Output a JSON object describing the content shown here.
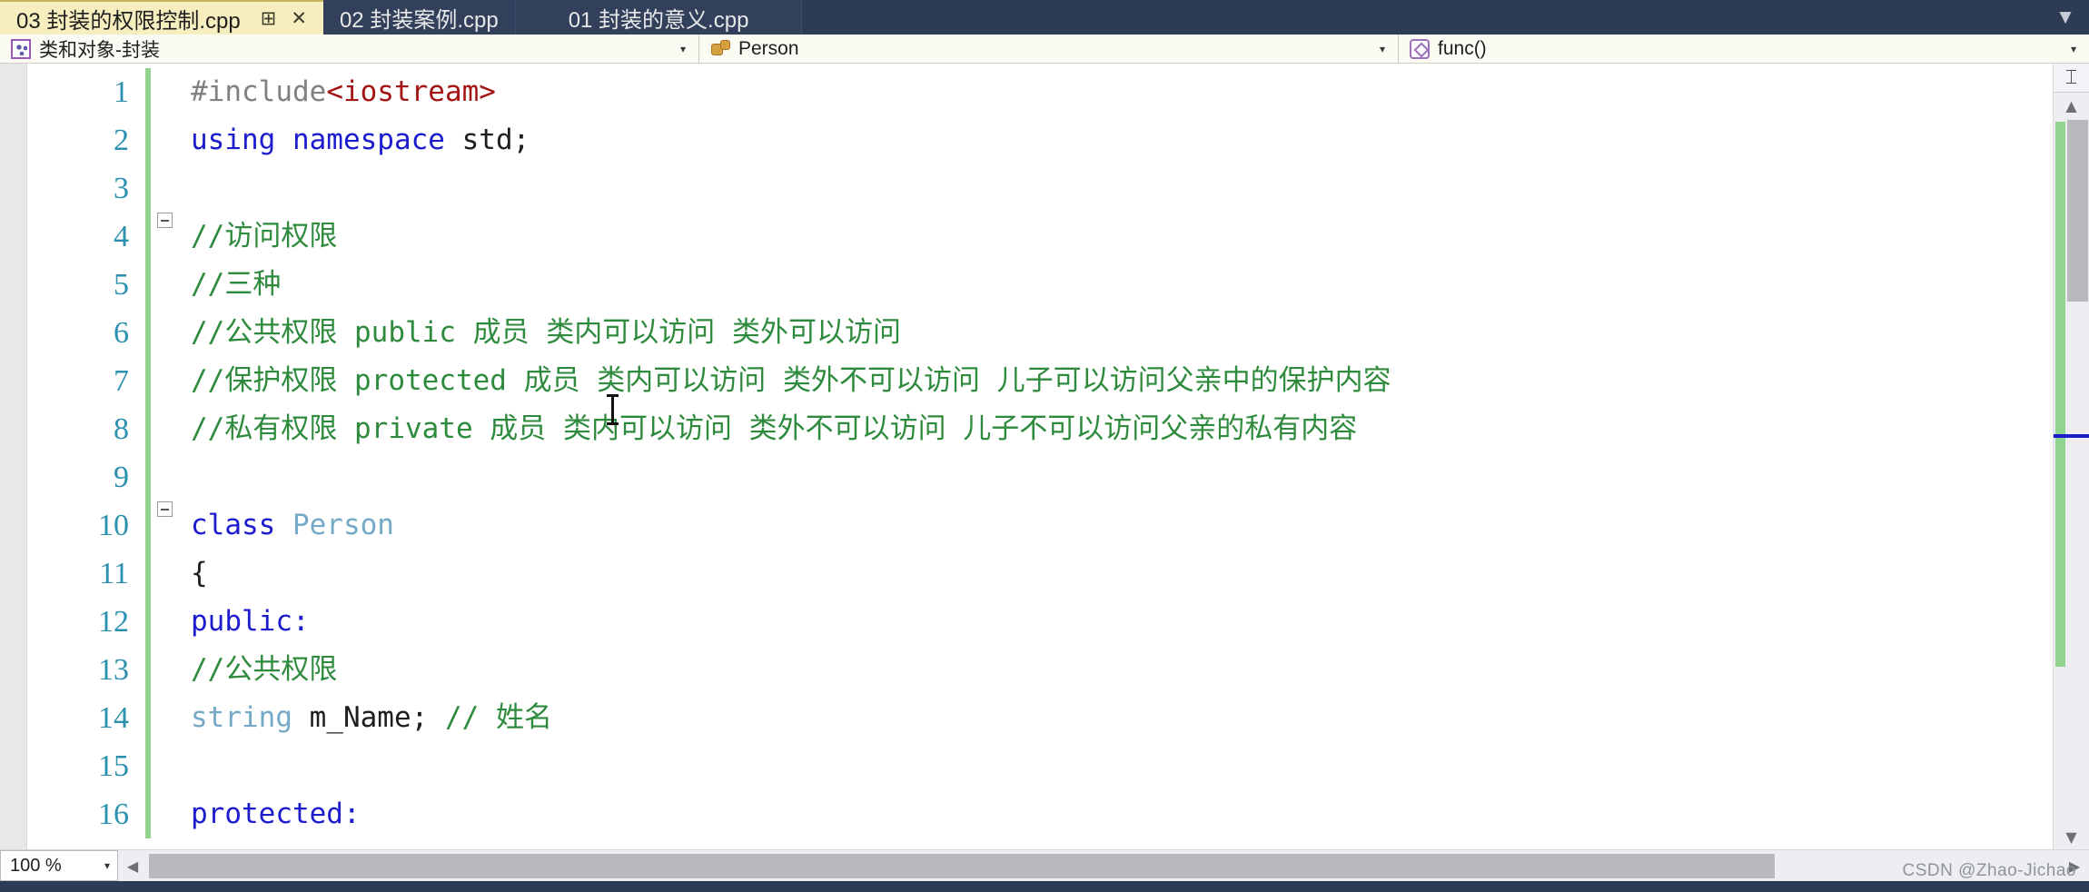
{
  "window": {
    "app": "Visual Studio",
    "theme_accent": "#2d3b55",
    "active_tab_bg": "#f7eec0"
  },
  "tabs": [
    {
      "label": "03 封装的权限控制.cpp",
      "active": true,
      "pin_icon": "pin-icon",
      "close_icon": "close-icon",
      "pin_glyph": "⊞",
      "close_glyph": "✕"
    },
    {
      "label": "02 封装案例.cpp",
      "active": false
    },
    {
      "label": "01 封装的意义.cpp",
      "active": false
    }
  ],
  "tabstrip": {
    "overflow_chevron": "▼"
  },
  "navbar": {
    "project": {
      "icon": "project-icon",
      "value": "类和对象-封装",
      "arrow": "▾"
    },
    "class": {
      "icon": "class-icon",
      "value": "Person",
      "arrow": "▾"
    },
    "function": {
      "icon": "function-icon",
      "value": "func()",
      "arrow": "▾"
    }
  },
  "editor": {
    "lines": [
      {
        "num": "1",
        "fold": "none",
        "changed": true,
        "tokens": [
          {
            "t": "#include",
            "c": "gray"
          },
          {
            "t": "<iostream>",
            "c": "red"
          }
        ]
      },
      {
        "num": "2",
        "fold": "none",
        "changed": true,
        "tokens": [
          {
            "t": "using namespace ",
            "c": "blue"
          },
          {
            "t": "std;",
            "c": "black"
          }
        ]
      },
      {
        "num": "3",
        "fold": "none",
        "changed": true,
        "tokens": [
          {
            "t": "",
            "c": "black"
          }
        ]
      },
      {
        "num": "4",
        "fold": "collapse",
        "changed": true,
        "tokens": [
          {
            "t": "//访问权限",
            "c": "green"
          }
        ]
      },
      {
        "num": "5",
        "fold": "line",
        "changed": true,
        "tokens": [
          {
            "t": "//三种",
            "c": "green"
          }
        ]
      },
      {
        "num": "6",
        "fold": "line",
        "changed": true,
        "tokens": [
          {
            "t": "//公共权限 public      成员 类内可以访问  类外可以访问",
            "c": "green"
          }
        ]
      },
      {
        "num": "7",
        "fold": "line",
        "changed": true,
        "tokens": [
          {
            "t": "//保护权限 protected   成员 类内可以访问  类外不可以访问   儿子可以访问父亲中的保护内容",
            "c": "green"
          }
        ]
      },
      {
        "num": "8",
        "fold": "line",
        "changed": true,
        "tokens": [
          {
            "t": "//私有权限 private     成员 类内可以访问  类外不可以访问   儿子不可以访问父亲的私有内容",
            "c": "green"
          }
        ]
      },
      {
        "num": "9",
        "fold": "none",
        "changed": true,
        "tokens": [
          {
            "t": "",
            "c": "black"
          }
        ]
      },
      {
        "num": "10",
        "fold": "collapse",
        "changed": true,
        "tokens": [
          {
            "t": "class ",
            "c": "blue"
          },
          {
            "t": "Person",
            "c": "teal"
          }
        ]
      },
      {
        "num": "11",
        "fold": "line",
        "changed": true,
        "tokens": [
          {
            "t": "{",
            "c": "black"
          }
        ]
      },
      {
        "num": "12",
        "fold": "line",
        "changed": true,
        "tokens": [
          {
            "t": "public:",
            "c": "blue"
          }
        ]
      },
      {
        "num": "13",
        "fold": "dotted",
        "changed": true,
        "tokens": [
          {
            "t": "    //公共权限",
            "c": "green"
          }
        ]
      },
      {
        "num": "14",
        "fold": "dotted",
        "changed": true,
        "tokens": [
          {
            "t": "   string ",
            "c": "teal"
          },
          {
            "t": "m_Name;  ",
            "c": "black"
          },
          {
            "t": "// 姓名",
            "c": "green"
          }
        ]
      },
      {
        "num": "15",
        "fold": "dotted",
        "changed": true,
        "tokens": [
          {
            "t": "",
            "c": "black"
          }
        ]
      },
      {
        "num": "16",
        "fold": "line",
        "changed": true,
        "tokens": [
          {
            "t": "protected:",
            "c": "blue"
          }
        ]
      }
    ]
  },
  "scrollbar": {
    "split_glyph": "⌶",
    "up_glyph": "▲",
    "down_glyph": "▼"
  },
  "statusbar": {
    "zoom_value": "100 %",
    "zoom_arrow": "▾",
    "hs_left_glyph": "◀",
    "hs_right_glyph": "▶"
  },
  "watermark": {
    "text": "CSDN @Zhao-Jichao"
  }
}
